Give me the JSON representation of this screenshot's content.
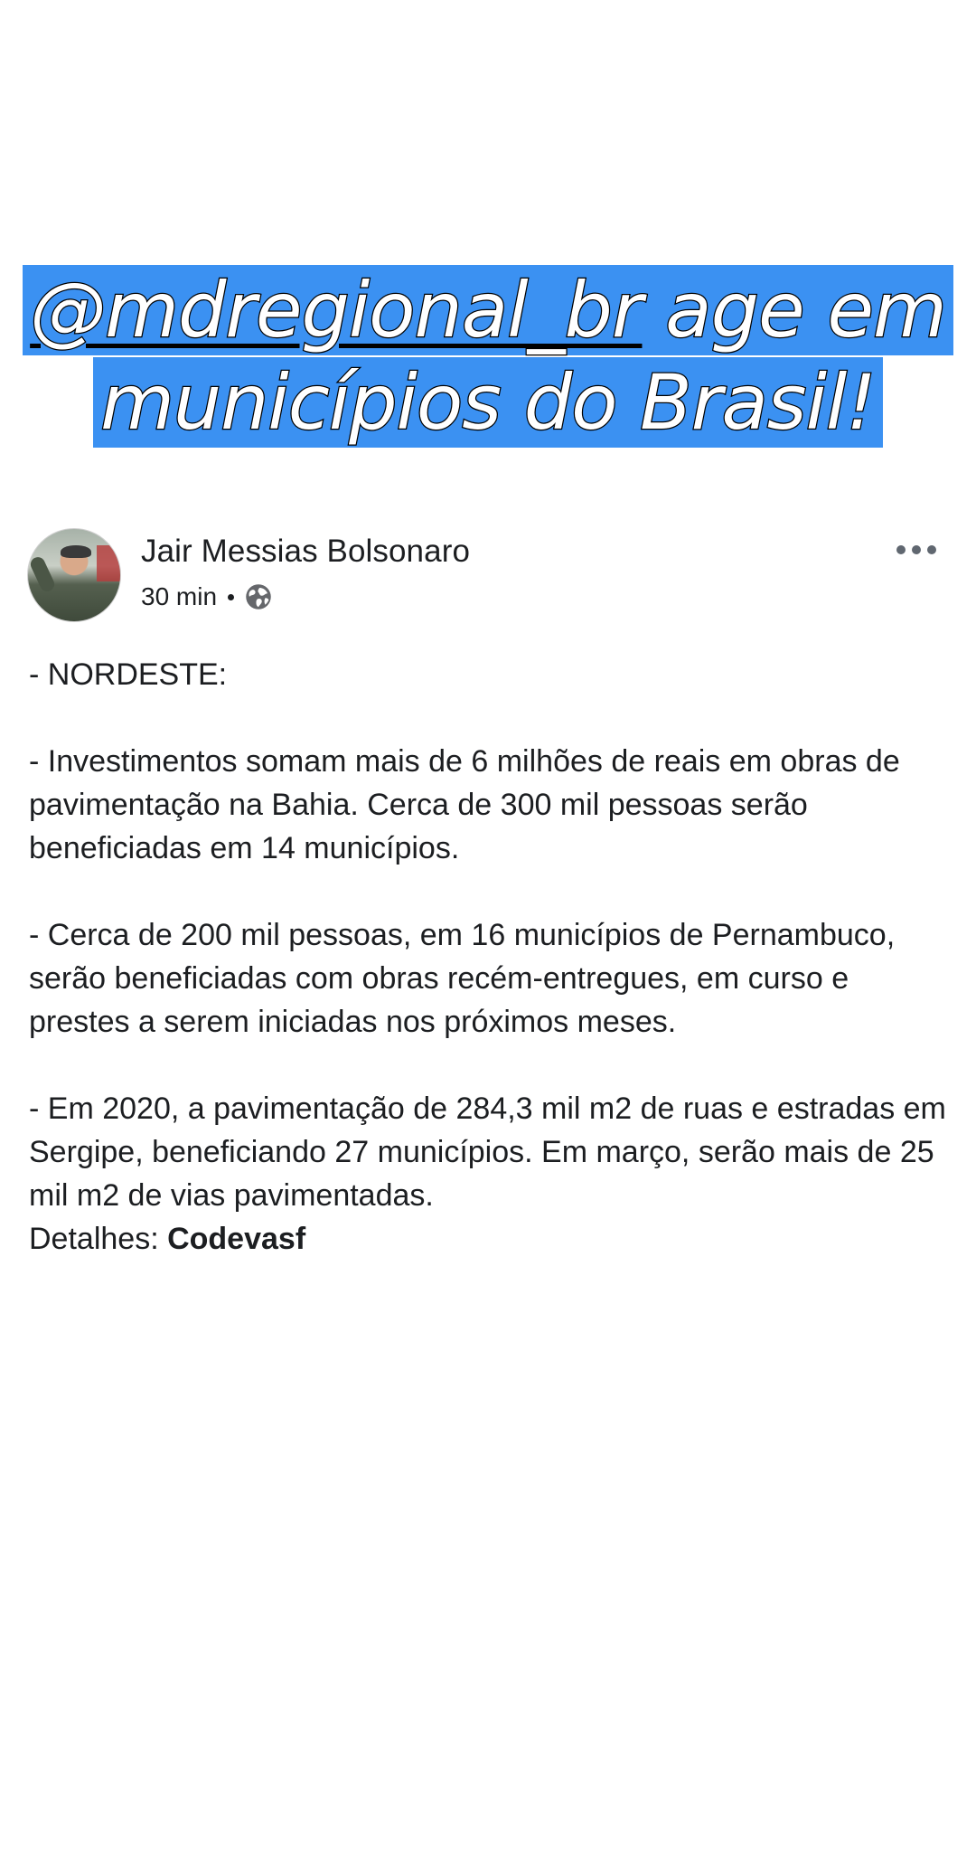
{
  "caption": {
    "mention": "@mdregional_br",
    "line1_rest": " age em",
    "line2": "municípios do Brasil!"
  },
  "post": {
    "author": "Jair Messias Bolsonaro",
    "timestamp": "30 min",
    "privacy_icon": "globe-icon",
    "more_icon": "more-options-icon",
    "paragraphs": [
      "- NORDESTE:",
      "- Investimentos somam mais de 6 milhões de reais em obras de pavimentação na Bahia. Cerca de 300 mil pessoas serão beneficiadas em 14 municípios.",
      "- Cerca de 200 mil pessoas, em 16 municípios de Pernambuco, serão beneficiadas com obras recém-entregues, em curso e prestes a serem iniciadas nos próximos meses.",
      "- Em 2020, a pavimentação de 284,3 mil m2 de ruas e estradas em Sergipe, beneficiando 27 municípios. Em março, serão mais de 25 mil m2 de vias pavimentadas."
    ],
    "details_label": "Detalhes: ",
    "details_link": "Codevasf"
  },
  "colors": {
    "caption_highlight": "#3b91f2",
    "text": "#1c1e21",
    "icon_gray": "#606770"
  }
}
